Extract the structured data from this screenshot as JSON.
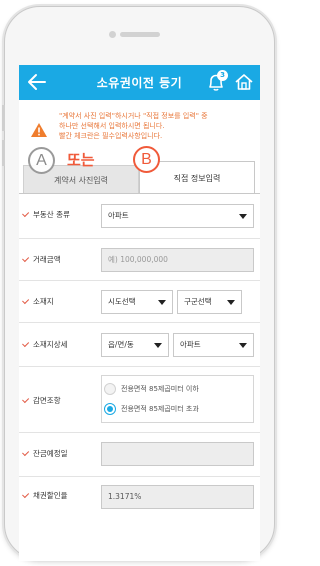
{
  "header": {
    "title": "소유권이전 등기",
    "notification_count": "3"
  },
  "notice": {
    "line1": "\"계약서 사진 입력\"하시거나 \"직접 정보를 입력\" 중",
    "line2": "하나만 선택해서 입력하시면 됩니다.",
    "line3": "빨간 체크란은 필수입력사항입니다."
  },
  "annotations": {
    "marker_a": "A",
    "marker_b": "B",
    "or_text": "또는"
  },
  "tabs": {
    "photo_label": "계약서 사진입력",
    "direct_label": "직접 정보입력"
  },
  "form": {
    "property_type": {
      "label": "부동산 종류",
      "value": "아파트"
    },
    "trade_amount": {
      "label": "거래금액",
      "placeholder": "예) 100,000,000"
    },
    "location": {
      "label": "소재지",
      "city": "시도선택",
      "district": "구군선택"
    },
    "location_detail": {
      "label": "소재지상세",
      "town": "읍/면/동",
      "building": "아파트"
    },
    "reduction": {
      "label": "감면조항",
      "option1": "전용면적 85제곱미터 이하",
      "option2": "전용면적 85제곱미터 초과",
      "selected": 2
    },
    "balance_date": {
      "label": "잔금예정일"
    },
    "bond_rate": {
      "label": "채권할인율",
      "value": "1.3171%"
    }
  },
  "colors": {
    "header": "#1aa9e4",
    "notice": "#e8773a",
    "required_check": "#e25b45",
    "marker_b": "#f05a3a"
  }
}
